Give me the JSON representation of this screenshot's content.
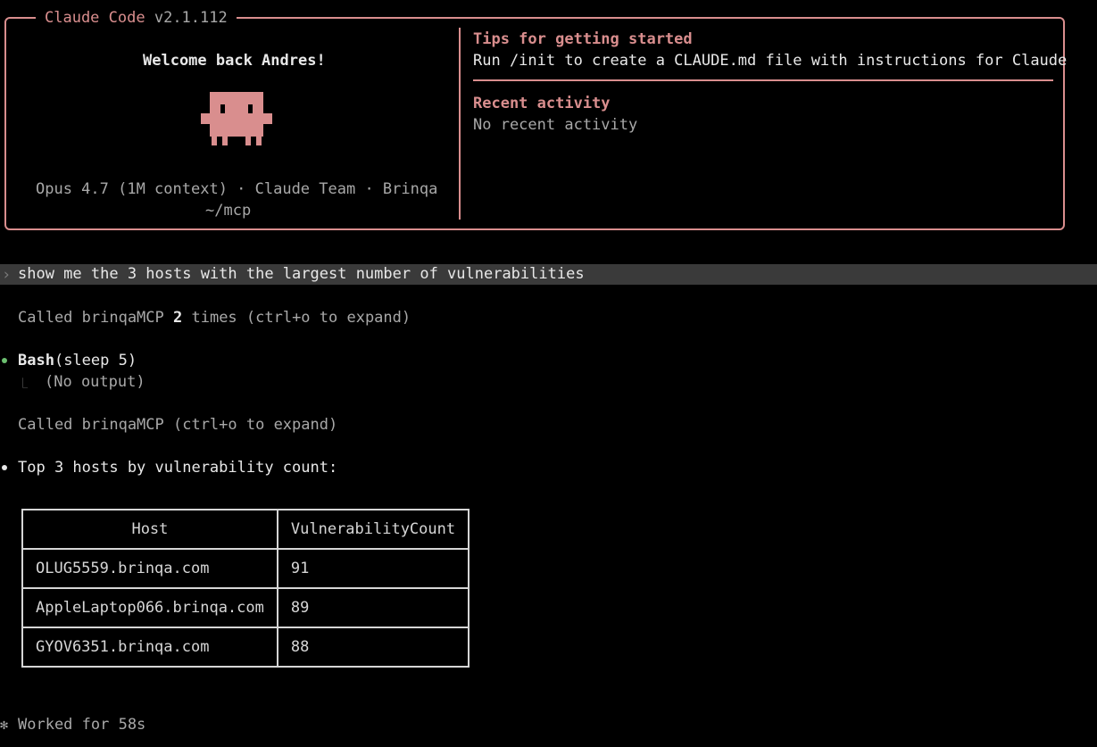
{
  "header": {
    "app_name": "Claude Code",
    "version": "v2.1.112",
    "welcome": "Welcome back Andres!",
    "model_info": "Opus 4.7 (1M context) · Claude Team · Brinqa",
    "cwd": "~/mcp",
    "tips_title": "Tips for getting started",
    "tips_text": "Run /init to create a CLAUDE.md file with instructions for Claude",
    "recent_title": "Recent activity",
    "recent_text": "No recent activity"
  },
  "prompt": {
    "caret": "›",
    "text": "show me the 3 hosts with the largest number of vulnerabilities"
  },
  "transcript": {
    "call1_prefix": "Called brinqaMCP ",
    "call1_count": "2",
    "call1_suffix": " times (ctrl+o to expand)",
    "bash_tool": "Bash",
    "bash_args": "(sleep 5)",
    "bash_result_glyph": "⎿",
    "bash_result": "(No output)",
    "call2": "Called brinqaMCP (ctrl+o to expand)",
    "answer": "Top 3 hosts by vulnerability count:",
    "worked_glyph": "✻",
    "worked": "Worked for 58s"
  },
  "table": {
    "headers": [
      "Host",
      "VulnerabilityCount"
    ],
    "rows": [
      [
        "OLUG5559.brinqa.com",
        "91"
      ],
      [
        "AppleLaptop066.brinqa.com",
        "89"
      ],
      [
        "GYOV6351.brinqa.com",
        "88"
      ]
    ]
  },
  "colors": {
    "accent": "#d98e8e",
    "background": "#000000",
    "prompt_bar": "#3a3a3a",
    "success_dot": "#6cc070",
    "text": "#d6d6d6"
  }
}
